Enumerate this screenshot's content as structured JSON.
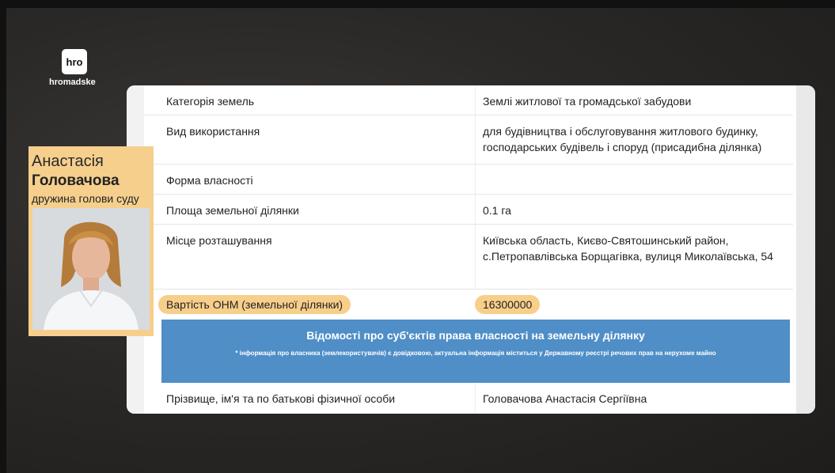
{
  "brand": {
    "logo_text": "hro",
    "name": "hromadske"
  },
  "table": {
    "rows": [
      {
        "key": "Категорія земель",
        "value": "Землі житлової та громадської забудови"
      },
      {
        "key": "Вид використання",
        "value": "для будівництва і обслуговування житлового будинку, господарських будівель і споруд (присадибна ділянка)"
      },
      {
        "key": "Форма власності",
        "value": ""
      },
      {
        "key": "Площа земельної ділянки",
        "value": "0.1 га"
      },
      {
        "key": "Місце розташування",
        "value": "Київська область, Києво-Святошинський район, с.Петропавлівська Борщагівка, вулиця Миколаївська, 54"
      },
      {
        "key": "Вартість ОНМ (земельної ділянки)",
        "value": "16300000"
      }
    ],
    "section_title": "Відомості про суб'єктів права власності на земельну ділянку",
    "section_note": "* інформація про власника (землекористувачів) є довідковою, актуальна інформація міститься у Державному реєстрі речових прав на нерухоме майно",
    "owner_row": {
      "key": "Прізвище, ім'я та по батькові фізичної особи",
      "value": "Головачова Анастасія Сергіївна"
    }
  },
  "caption": {
    "first_name": "Анастасія",
    "last_name": "Головачова",
    "role": "дружина голови суду"
  },
  "colors": {
    "highlight": "#f8cf8a",
    "banner": "#4f8ec7"
  }
}
